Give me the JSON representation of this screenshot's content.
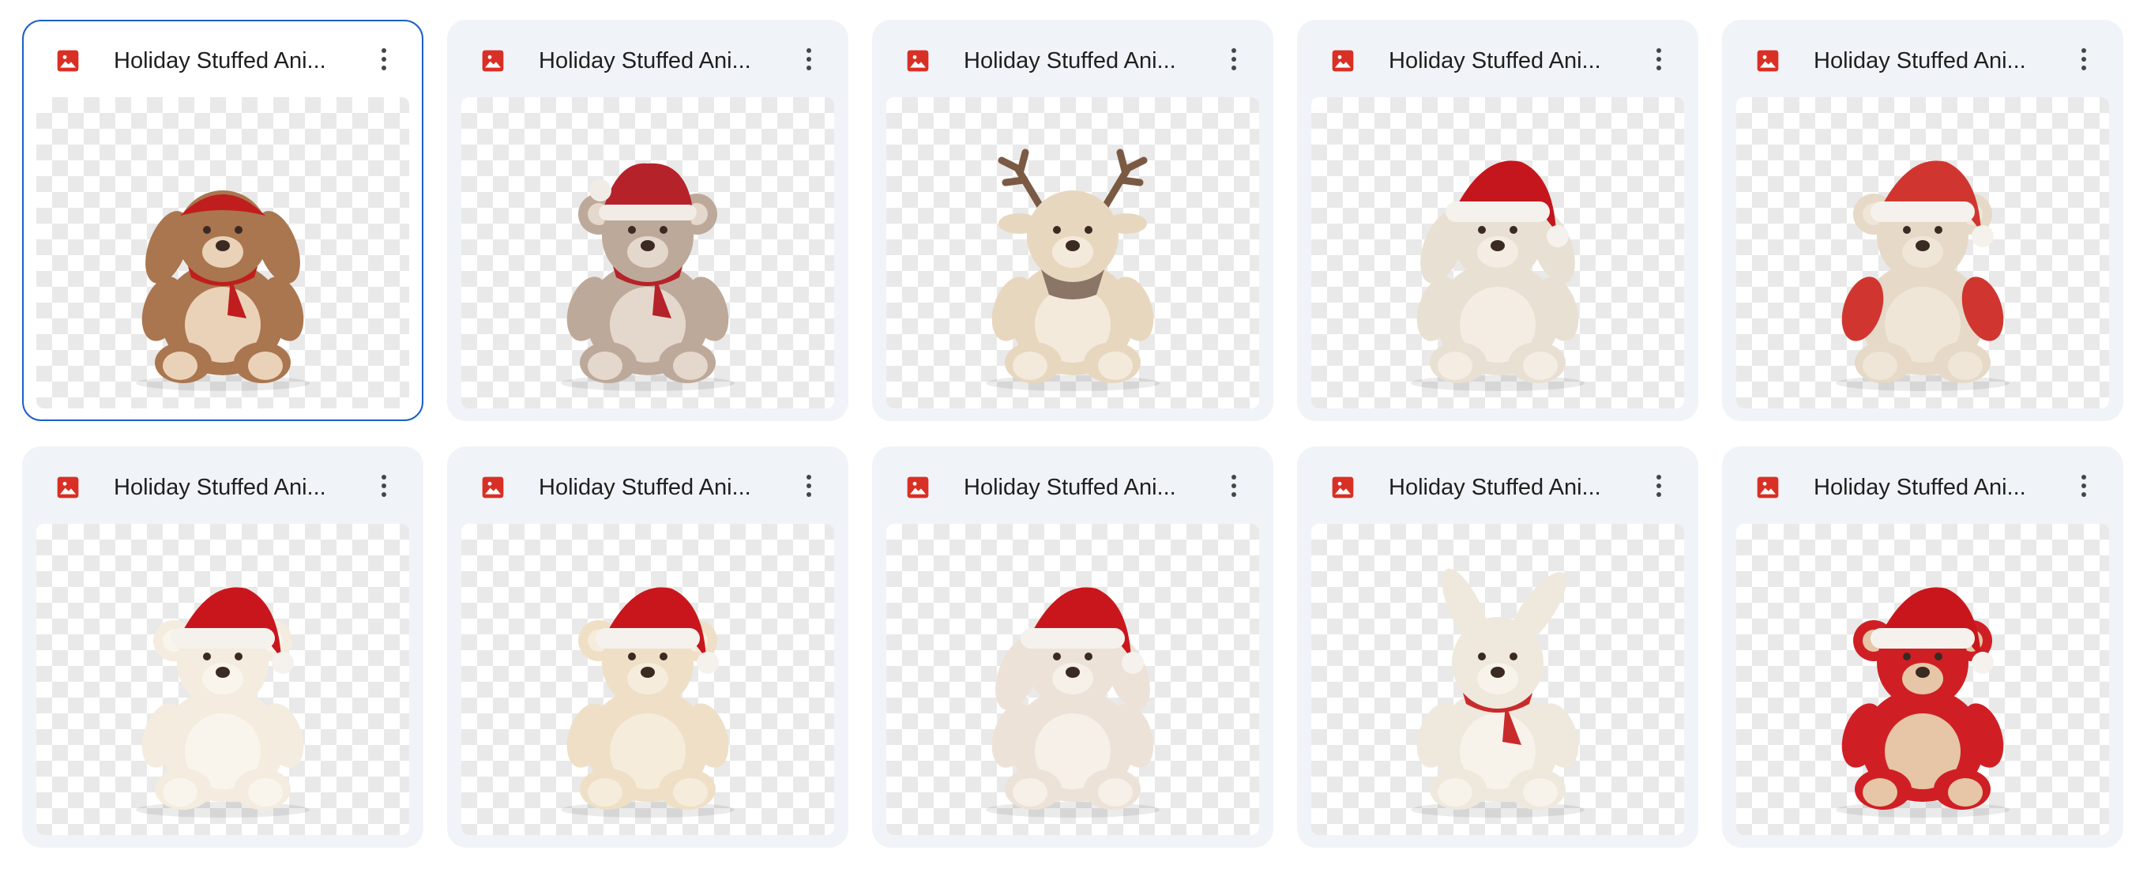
{
  "files": [
    {
      "title": "Holiday Stuffed Ani...",
      "selected": true,
      "subject": "brown-bunny-with-bandana",
      "body": "#a9764f",
      "belly": "#ead2b8",
      "accent": "#c01e1e",
      "hat": "bandana",
      "ears": "floppy"
    },
    {
      "title": "Holiday Stuffed Ani...",
      "selected": false,
      "subject": "teddy-with-knit-hat-scarf",
      "body": "#bda99a",
      "belly": "#e4d7cb",
      "accent": "#b6222a",
      "hat": "knit",
      "ears": "round"
    },
    {
      "title": "Holiday Stuffed Ani...",
      "selected": false,
      "subject": "reindeer-plush",
      "body": "#e8d7bf",
      "belly": "#f4eadb",
      "accent": "#7b5a44",
      "hat": "none",
      "ears": "antlers"
    },
    {
      "title": "Holiday Stuffed Ani...",
      "selected": false,
      "subject": "lamb-with-santa-hat",
      "body": "#e8e0d2",
      "belly": "#f3ede3",
      "accent": "#c4161c",
      "hat": "santa",
      "ears": "floppy"
    },
    {
      "title": "Holiday Stuffed Ani...",
      "selected": false,
      "subject": "bear-with-red-arms",
      "body": "#e6d9c7",
      "belly": "#efe6d8",
      "accent": "#d0362f",
      "hat": "santa",
      "ears": "round"
    },
    {
      "title": "Holiday Stuffed Ani...",
      "selected": false,
      "subject": "white-bear-with-santa-hat",
      "body": "#f3ecdf",
      "belly": "#faf5ec",
      "accent": "#c8161c",
      "hat": "santa",
      "ears": "round"
    },
    {
      "title": "Holiday Stuffed Ani...",
      "selected": false,
      "subject": "cream-bear-with-santa-hat",
      "body": "#eedfc6",
      "belly": "#f6ecdb",
      "accent": "#c8161c",
      "hat": "santa",
      "ears": "round"
    },
    {
      "title": "Holiday Stuffed Ani...",
      "selected": false,
      "subject": "puppy-with-santa-hat",
      "body": "#ece2d8",
      "belly": "#f6f0e8",
      "accent": "#c8161c",
      "hat": "santa",
      "ears": "floppy"
    },
    {
      "title": "Holiday Stuffed Ani...",
      "selected": false,
      "subject": "bunny-with-red-scarf",
      "body": "#efe8dd",
      "belly": "#f7f2ea",
      "accent": "#c92b2b",
      "hat": "none",
      "ears": "bunny"
    },
    {
      "title": "Holiday Stuffed Ani...",
      "selected": false,
      "subject": "red-monkey-with-santa-hat",
      "body": "#cf1f25",
      "belly": "#e6c6a6",
      "accent": "#c8161c",
      "hat": "santa",
      "ears": "monkey"
    }
  ],
  "icons": {
    "file_type": "image-file-icon",
    "more": "more-vert-icon"
  },
  "colors": {
    "card_bg": "#f0f4f9",
    "selected_border": "#1b5fc8",
    "file_icon_red": "#d93025",
    "title_text": "#1f1f1f"
  }
}
